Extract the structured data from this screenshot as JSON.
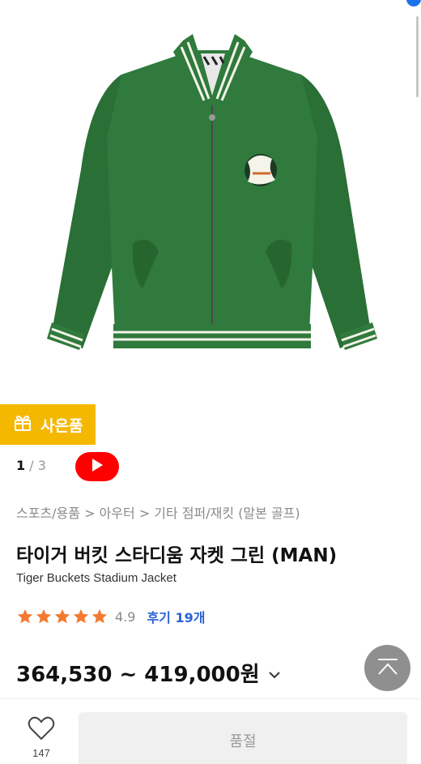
{
  "product": {
    "gift_label": "사은품",
    "image_index": "1",
    "image_total": "3",
    "breadcrumb": "스포츠/용품 > 아우터 > 기타 점퍼/재킷 (말본 골프)",
    "title": "타이거 버킷 스타디움 자켓 그린 (MAN)",
    "subtitle": "Tiger Buckets Stadium Jacket",
    "rating": "4.9",
    "review_link": "후기 19개",
    "price_range": "364,530 ~ 419,000원"
  },
  "bottom_bar": {
    "wish_count": "147",
    "soldout_label": "품절"
  },
  "icons": [
    "gift-icon",
    "play-icon",
    "star-icon",
    "chevron-down-icon",
    "scroll-top-icon",
    "heart-icon"
  ],
  "colors": {
    "jacket_green": "#2f7a3c",
    "gift_tag": "#f5b800",
    "video_red": "#ff0000",
    "star_orange": "#f47a30",
    "review_blue": "#2a63d6"
  }
}
